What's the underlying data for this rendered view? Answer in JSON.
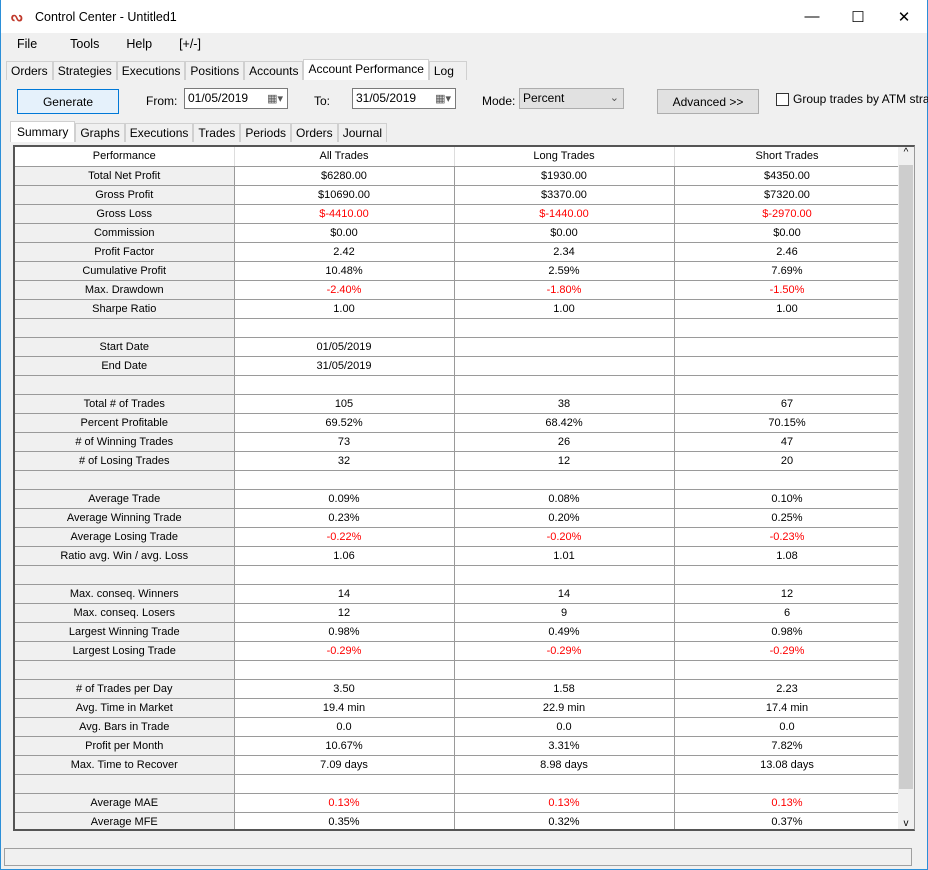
{
  "window": {
    "title": "Control Center - Untitled1",
    "minimize": "—",
    "maximize": "☐",
    "close": "✕"
  },
  "menu": [
    "File",
    "Tools",
    "Help",
    "[+/-]"
  ],
  "main_tabs": [
    "Orders",
    "Strategies",
    "Executions",
    "Positions",
    "Accounts",
    "Account Performance",
    "Log"
  ],
  "active_main_tab": "Account Performance",
  "toolbar": {
    "generate": "Generate",
    "from_label": "From:",
    "from_value": "01/05/2019",
    "to_label": "To:",
    "to_value": "31/05/2019",
    "mode_label": "Mode:",
    "mode_value": "Percent",
    "advanced": "Advanced >>",
    "group_label": "Group trades by ATM strate",
    "group_checked": false
  },
  "sub_tabs": [
    "Summary",
    "Graphs",
    "Executions",
    "Trades",
    "Periods",
    "Orders",
    "Journal"
  ],
  "active_sub_tab": "Summary",
  "colors": {
    "negative": "#ff0000",
    "accent": "#2b8fd8"
  },
  "table": {
    "headers": [
      "Performance",
      "All Trades",
      "Long Trades",
      "Short Trades"
    ],
    "rows": [
      {
        "label": "Total Net Profit",
        "values": [
          "$6280.00",
          "$1930.00",
          "$4350.00"
        ]
      },
      {
        "label": "Gross Profit",
        "values": [
          "$10690.00",
          "$3370.00",
          "$7320.00"
        ]
      },
      {
        "label": "Gross Loss",
        "values": [
          "$-4410.00",
          "$-1440.00",
          "$-2970.00"
        ],
        "red": true
      },
      {
        "label": "Commission",
        "values": [
          "$0.00",
          "$0.00",
          "$0.00"
        ]
      },
      {
        "label": "Profit Factor",
        "values": [
          "2.42",
          "2.34",
          "2.46"
        ]
      },
      {
        "label": "Cumulative Profit",
        "values": [
          "10.48%",
          "2.59%",
          "7.69%"
        ]
      },
      {
        "label": "Max. Drawdown",
        "values": [
          "-2.40%",
          "-1.80%",
          "-1.50%"
        ],
        "red": true
      },
      {
        "label": "Sharpe Ratio",
        "values": [
          "1.00",
          "1.00",
          "1.00"
        ]
      },
      {
        "label": "",
        "values": [
          "",
          "",
          ""
        ]
      },
      {
        "label": "Start Date",
        "values": [
          "01/05/2019",
          "",
          ""
        ]
      },
      {
        "label": "End Date",
        "values": [
          "31/05/2019",
          "",
          ""
        ]
      },
      {
        "label": "",
        "values": [
          "",
          "",
          ""
        ]
      },
      {
        "label": "Total # of Trades",
        "values": [
          "105",
          "38",
          "67"
        ]
      },
      {
        "label": "Percent Profitable",
        "values": [
          "69.52%",
          "68.42%",
          "70.15%"
        ]
      },
      {
        "label": "# of Winning Trades",
        "values": [
          "73",
          "26",
          "47"
        ]
      },
      {
        "label": "# of Losing Trades",
        "values": [
          "32",
          "12",
          "20"
        ]
      },
      {
        "label": "",
        "values": [
          "",
          "",
          ""
        ]
      },
      {
        "label": "Average Trade",
        "values": [
          "0.09%",
          "0.08%",
          "0.10%"
        ]
      },
      {
        "label": "Average Winning Trade",
        "values": [
          "0.23%",
          "0.20%",
          "0.25%"
        ]
      },
      {
        "label": "Average Losing Trade",
        "values": [
          "-0.22%",
          "-0.20%",
          "-0.23%"
        ],
        "red": true
      },
      {
        "label": "Ratio avg. Win / avg. Loss",
        "values": [
          "1.06",
          "1.01",
          "1.08"
        ]
      },
      {
        "label": "",
        "values": [
          "",
          "",
          ""
        ]
      },
      {
        "label": "Max. conseq. Winners",
        "values": [
          "14",
          "14",
          "12"
        ]
      },
      {
        "label": "Max. conseq. Losers",
        "values": [
          "12",
          "9",
          "6"
        ]
      },
      {
        "label": "Largest Winning Trade",
        "values": [
          "0.98%",
          "0.49%",
          "0.98%"
        ]
      },
      {
        "label": "Largest Losing Trade",
        "values": [
          "-0.29%",
          "-0.29%",
          "-0.29%"
        ],
        "red": true
      },
      {
        "label": "",
        "values": [
          "",
          "",
          ""
        ]
      },
      {
        "label": "# of Trades per Day",
        "values": [
          "3.50",
          "1.58",
          "2.23"
        ]
      },
      {
        "label": "Avg. Time in Market",
        "values": [
          "19.4 min",
          "22.9 min",
          "17.4 min"
        ]
      },
      {
        "label": "Avg. Bars in Trade",
        "values": [
          "0.0",
          "0.0",
          "0.0"
        ]
      },
      {
        "label": "Profit per Month",
        "values": [
          "10.67%",
          "3.31%",
          "7.82%"
        ]
      },
      {
        "label": "Max. Time to Recover",
        "values": [
          "7.09 days",
          "8.98 days",
          "13.08 days"
        ]
      },
      {
        "label": "",
        "values": [
          "",
          "",
          ""
        ]
      },
      {
        "label": "Average MAE",
        "values": [
          "0.13%",
          "0.13%",
          "0.13%"
        ],
        "red": true
      },
      {
        "label": "Average MFE",
        "values": [
          "0.35%",
          "0.32%",
          "0.37%"
        ]
      }
    ]
  }
}
